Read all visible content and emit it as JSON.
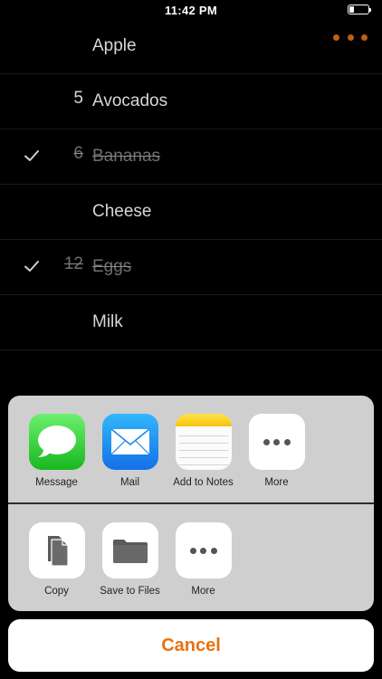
{
  "status_bar": {
    "time": "11:42 PM",
    "battery_level": 0.25
  },
  "list": {
    "items": [
      {
        "quantity": "",
        "name": "Apple",
        "checked": false
      },
      {
        "quantity": "5",
        "name": "Avocados",
        "checked": false
      },
      {
        "quantity": "6",
        "name": "Bananas",
        "checked": true
      },
      {
        "quantity": "",
        "name": "Cheese",
        "checked": false
      },
      {
        "quantity": "12",
        "name": "Eggs",
        "checked": true
      },
      {
        "quantity": "",
        "name": "Milk",
        "checked": false
      }
    ]
  },
  "share_sheet": {
    "apps": [
      {
        "label": "Message",
        "icon": "message-icon"
      },
      {
        "label": "Mail",
        "icon": "mail-icon"
      },
      {
        "label": "Add to Notes",
        "icon": "notes-icon"
      },
      {
        "label": "More",
        "icon": "more-icon"
      }
    ],
    "actions": [
      {
        "label": "Copy",
        "icon": "copy-icon"
      },
      {
        "label": "Save to Files",
        "icon": "folder-icon"
      },
      {
        "label": "More",
        "icon": "more-icon"
      }
    ],
    "cancel_label": "Cancel"
  },
  "colors": {
    "accent": "#e8720f",
    "menu_dots": "#c05f12",
    "sheet_bg": "#cfcfcf"
  }
}
